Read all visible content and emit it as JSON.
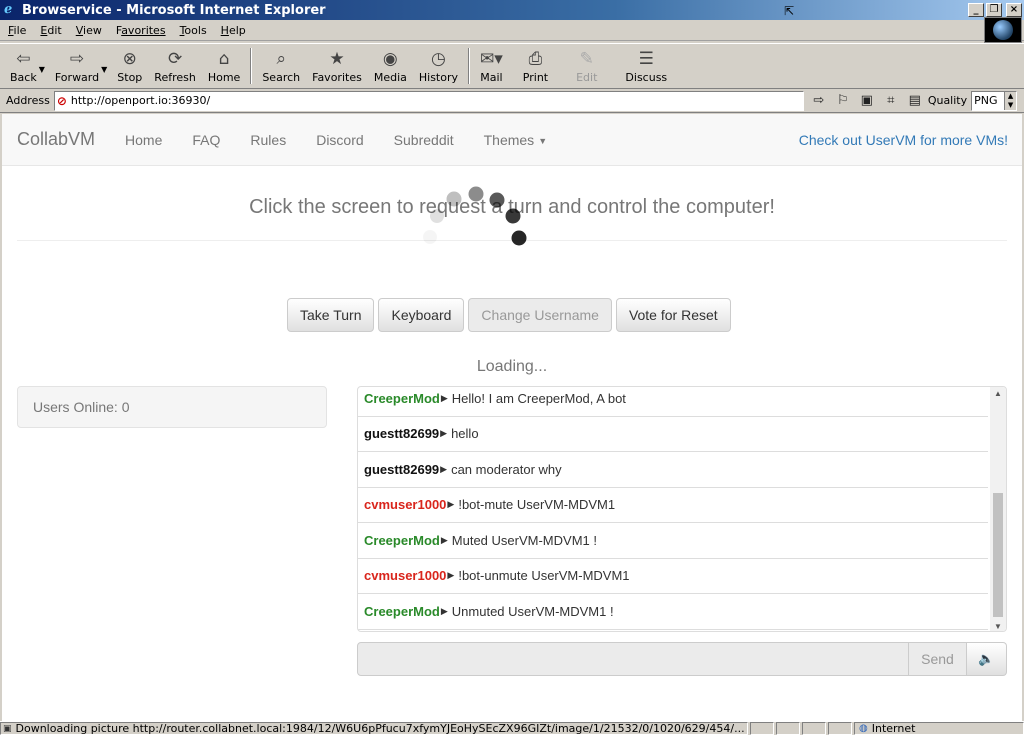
{
  "window": {
    "title": "Browservice - Microsoft Internet Explorer",
    "controls": [
      "_",
      "❐",
      "×"
    ]
  },
  "menu": [
    {
      "key": "F",
      "rest": "ile"
    },
    {
      "key": "E",
      "rest": "dit"
    },
    {
      "key": "V",
      "rest": "iew"
    },
    {
      "key": "F",
      "rest": "avorites",
      "pre": ""
    },
    {
      "key": "T",
      "rest": "ools"
    },
    {
      "key": "H",
      "rest": "elp"
    }
  ],
  "toolbar": {
    "back": "Back",
    "forward": "Forward",
    "stop": "Stop",
    "refresh": "Refresh",
    "home": "Home",
    "search": "Search",
    "favorites": "Favorites",
    "media": "Media",
    "history": "History",
    "mail": "Mail",
    "print": "Print",
    "edit": "Edit",
    "discuss": "Discuss"
  },
  "address": {
    "label": "Address",
    "url": "http://openport.io:36930/",
    "quality_label": "Quality",
    "quality_value": "PNG"
  },
  "nav": {
    "brand": "CollabVM",
    "links": [
      "Home",
      "FAQ",
      "Rules",
      "Discord",
      "Subreddit",
      "Themes"
    ],
    "right_link": "Check out UserVM for more VMs!"
  },
  "vm": {
    "heading": "Click the screen to request a turn and control the computer!",
    "loading": "Loading..."
  },
  "buttons": {
    "take_turn": "Take Turn",
    "keyboard": "Keyboard",
    "change_username": "Change Username",
    "vote_reset": "Vote for Reset"
  },
  "users": {
    "online_text": "Users Online: 0"
  },
  "chat": {
    "messages": [
      {
        "user": "CreeperMod",
        "text": "Hello! I am CreeperMod, A bot",
        "color": "green"
      },
      {
        "user": "guestt82699",
        "text": "hello",
        "color": "black"
      },
      {
        "user": "guestt82699",
        "text": "can moderator why",
        "color": "black"
      },
      {
        "user": "cvmuser1000",
        "text": "!bot-mute UserVM-MDVM1",
        "color": "red"
      },
      {
        "user": "CreeperMod",
        "text": "Muted UserVM-MDVM1 !",
        "color": "green"
      },
      {
        "user": "cvmuser1000",
        "text": "!bot-unmute UserVM-MDVM1",
        "color": "red"
      },
      {
        "user": "CreeperMod",
        "text": "Unmuted UserVM-MDVM1 !",
        "color": "green"
      }
    ],
    "send_label": "Send",
    "input_value": ""
  },
  "status": {
    "text": "Downloading picture http://router.collabnet.local:1984/12/W6U6pPfucu7xfymYJEoHySEcZX96GIZt/image/1/21532/0/1020/629/454/...",
    "zone": "Internet"
  },
  "colors": {
    "title_gradient_start": "#0a246a",
    "link_blue": "#337ab7",
    "user_green": "#2a8a2a",
    "user_red": "#d9251c"
  }
}
